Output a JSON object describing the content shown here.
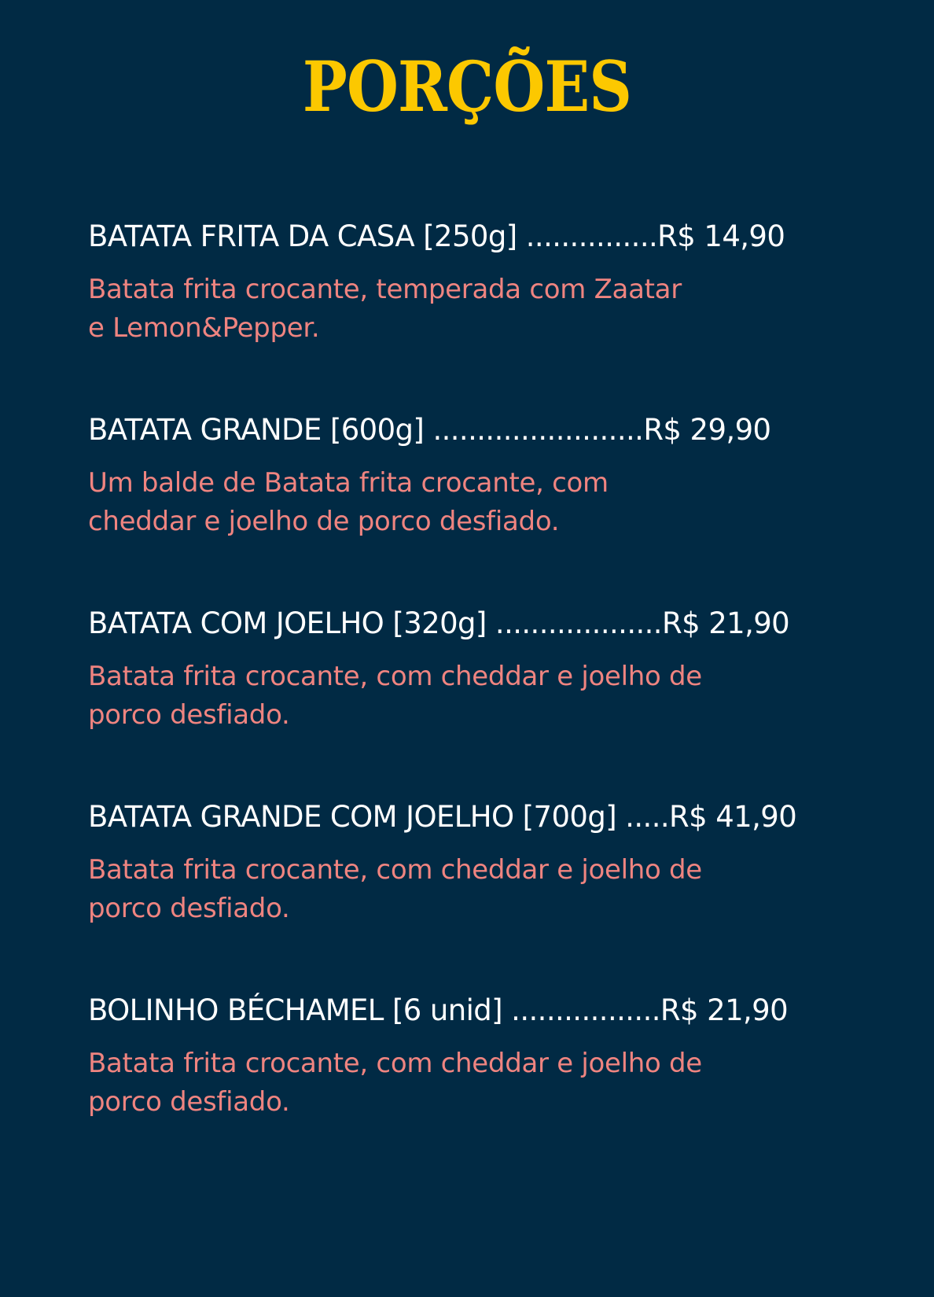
{
  "colors": {
    "background": "#012a44",
    "title": "#fcc800",
    "item_name": "#ffffff",
    "description": "#ef8480"
  },
  "menu": {
    "title": "PORÇÕES",
    "items": [
      {
        "name": "BATATA FRITA DA CASA [250g] ",
        "dots": "...............",
        "price": "R$ 14,90",
        "description": [
          "Batata frita crocante, temperada com Zaatar",
          "e Lemon&Pepper."
        ]
      },
      {
        "name": "BATATA GRANDE [600g] ",
        "dots": "........................",
        "price": "R$ 29,90",
        "description": [
          "Um balde de Batata frita crocante, com",
          "cheddar e joelho de porco desfiado."
        ]
      },
      {
        "name": "BATATA COM JOELHO [320g] ",
        "dots": "...................",
        "price": "R$ 21,90",
        "description": [
          "Batata frita crocante, com cheddar e joelho de",
          "porco desfiado."
        ]
      },
      {
        "name": "BATATA GRANDE COM JOELHO [700g] ",
        "dots": ".....",
        "price": "R$ 41,90",
        "description": [
          "Batata frita crocante, com cheddar e joelho de",
          "porco desfiado."
        ]
      },
      {
        "name": "BOLINHO BÉCHAMEL [6 unid] ",
        "dots": ".................",
        "price": "R$ 21,90",
        "description": [
          "Batata frita crocante, com cheddar e joelho de",
          "porco desfiado."
        ]
      }
    ]
  }
}
